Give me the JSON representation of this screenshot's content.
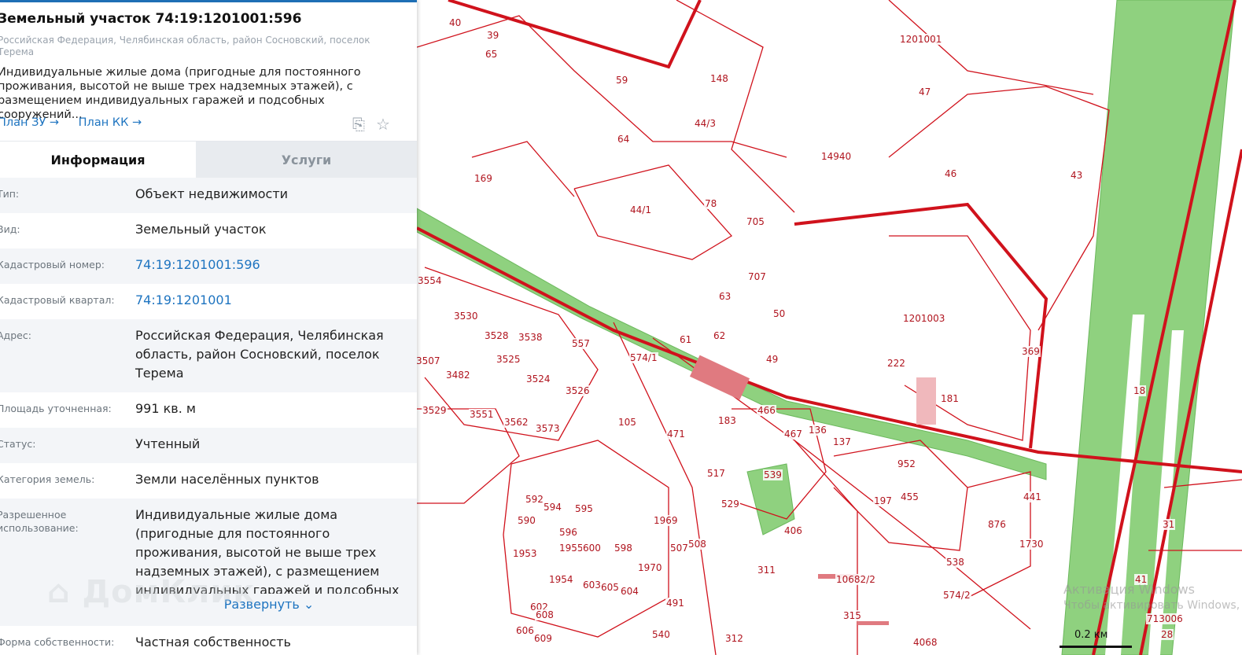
{
  "panel": {
    "title": "Земельный участок 74:19:1201001:596",
    "address_short": "Российская Федерация, Челябинская область, район Сосновский, поселок Терема",
    "description": "Индивидуальные жилые дома (пригодные для постоянного проживания, высотой не выше трех надземных этажей), с размещением индивидуальных гаражей и подсобных сооружений...",
    "links": [
      "План ЗУ →",
      "План КК →"
    ],
    "icons": [
      "search-document-icon",
      "star-icon"
    ],
    "tabs": [
      "Информация",
      "Услуги"
    ],
    "rows": [
      {
        "label": "Тип:",
        "value": "Объект недвижимости"
      },
      {
        "label": "Вид:",
        "value": "Земельный участок"
      },
      {
        "label": "Кадастровый номер:",
        "value": "74:19:1201001:596"
      },
      {
        "label": "Кадастровый квартал:",
        "value": "74:19:1201001"
      },
      {
        "label": "Адрес:",
        "value": "Российская Федерация, Челябинская область, район Сосновский, поселок Терема"
      },
      {
        "label": "Площадь уточненная:",
        "value": "991 кв. м"
      },
      {
        "label": "Статус:",
        "value": "Учтенный"
      },
      {
        "label": "Категория земель:",
        "value": "Земли населённых пунктов"
      },
      {
        "label": "Разрешенное использование:",
        "value": "Индивидуальные жилые дома (пригодные для постоянного проживания, высотой не выше трех надземных этажей), с размещением индивидуальных гаражей и подсобных",
        "expand": "Развернуть ⌄"
      },
      {
        "label": "Форма собственности:",
        "value": "Частная собственность"
      }
    ],
    "watermark": "ДомКлик"
  },
  "map": {
    "labels": [
      "40",
      "39",
      "65",
      "59",
      "148",
      "44/3",
      "64",
      "169",
      "44/1",
      "78",
      "705",
      "707",
      "63",
      "50",
      "49",
      "62",
      "61",
      "557",
      "574/1",
      "3554",
      "3530",
      "3528",
      "3538",
      "3525",
      "3524",
      "3507",
      "3482",
      "3526",
      "3529",
      "3551",
      "3562",
      "3573",
      "105",
      "471",
      "183",
      "466",
      "517",
      "529",
      "539",
      "406",
      "467",
      "136",
      "137",
      "222",
      "1201003",
      "1201001",
      "47",
      "14940",
      "46",
      "43",
      "181",
      "369",
      "952",
      "197",
      "455",
      "441",
      "1730",
      "876",
      "538",
      "574/2",
      "10682/2",
      "311",
      "315",
      "312",
      "4068",
      "1953",
      "1954",
      "1955",
      "592",
      "594",
      "595",
      "590",
      "596",
      "598",
      "600",
      "603",
      "605",
      "604",
      "1970",
      "1969",
      "507",
      "508",
      "491",
      "540",
      "602",
      "606",
      "608",
      "609",
      "713006",
      "31",
      "41",
      "28",
      "18"
    ],
    "scale_label": "0.2 км",
    "windows_activation": [
      "Активация Windows",
      "Чтобы активировать Windows,"
    ]
  }
}
